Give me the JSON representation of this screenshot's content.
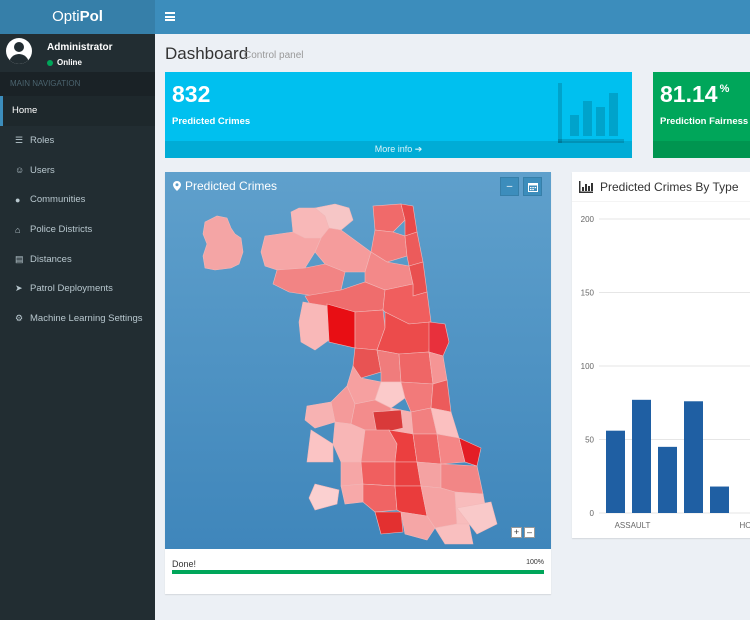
{
  "brand": {
    "prefix": "Opti",
    "bold": "Pol"
  },
  "user": {
    "name": "Administrator",
    "status": "Online"
  },
  "nav": {
    "header": "MAIN NAVIGATION",
    "items": [
      {
        "label": "Home",
        "icon": "home-icon"
      },
      {
        "label": "Roles",
        "icon": "list-icon"
      },
      {
        "label": "Users",
        "icon": "users-icon"
      },
      {
        "label": "Communities",
        "icon": "map-marker-icon"
      },
      {
        "label": "Police Districts",
        "icon": "bank-icon"
      },
      {
        "label": "Distances",
        "icon": "map-icon"
      },
      {
        "label": "Patrol Deployments",
        "icon": "location-arrow-icon"
      },
      {
        "label": "Machine Learning Settings",
        "icon": "cog-icon"
      }
    ]
  },
  "page": {
    "title": "Dashboard",
    "subtitle": "Control panel"
  },
  "stats": {
    "predicted": {
      "value": "832",
      "label": "Predicted Crimes",
      "footer": "More info ➔"
    },
    "fairness": {
      "value": "81.14",
      "unit": "%",
      "label": "Prediction Fairness"
    }
  },
  "map": {
    "title": "Predicted Crimes",
    "progress_label": "Done!",
    "progress_text": "100%",
    "progress": 1.0
  },
  "colors": {
    "sidebar": "#222d32",
    "topbar": "#3c8dbc",
    "aqua": "#00c0ef",
    "green": "#00a65a",
    "bar": "#1f5fa3"
  },
  "chart_data": {
    "type": "bar",
    "title": "Predicted Crimes By Type",
    "categories": [
      "ASSAULT",
      "",
      "",
      "",
      "",
      "HOMICIDE"
    ],
    "values": [
      56,
      77,
      45,
      76,
      18,
      0
    ],
    "yticks": [
      0,
      50,
      100,
      150,
      200
    ],
    "ylim": [
      0,
      200
    ],
    "grid": true
  }
}
